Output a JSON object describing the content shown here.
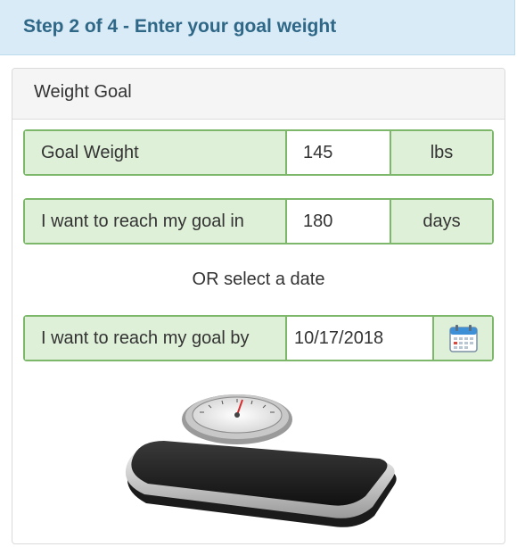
{
  "header": {
    "title": "Step 2 of 4 - Enter your goal weight"
  },
  "panel": {
    "title": "Weight Goal",
    "goal_weight": {
      "label": "Goal Weight",
      "value": "145",
      "unit": "lbs"
    },
    "goal_days": {
      "label": "I want to reach my goal in",
      "value": "180",
      "unit": "days"
    },
    "or_text": "OR select a date",
    "goal_date": {
      "label": "I want to reach my goal by",
      "value": "10/17/2018",
      "icon": "calendar-icon"
    }
  },
  "image": {
    "icon": "bathroom-scale"
  }
}
